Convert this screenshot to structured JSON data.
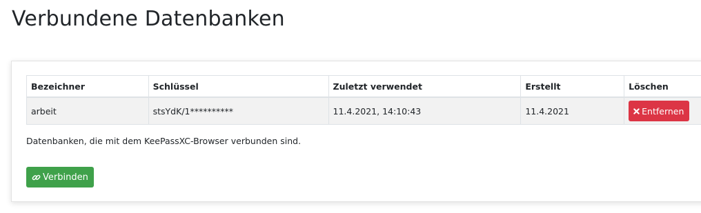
{
  "page": {
    "title": "Verbundene Datenbanken"
  },
  "table": {
    "headers": [
      "Bezeichner",
      "Schlüssel",
      "Zuletzt verwendet",
      "Erstellt",
      "Löschen"
    ],
    "rows": [
      {
        "name": "arbeit",
        "key": "stsYdK/1**********",
        "last_used": "11.4.2021, 14:10:43",
        "created": "11.4.2021",
        "remove_label": "Entfernen"
      }
    ]
  },
  "info_text": "Datenbanken, die mit dem KeePassXC-Browser verbunden sind.",
  "connect_button": {
    "label": "Verbinden"
  },
  "colors": {
    "remove": "#dc3545",
    "connect": "#3fa14a"
  },
  "icons": {
    "remove": "times-icon",
    "connect": "link-icon"
  }
}
